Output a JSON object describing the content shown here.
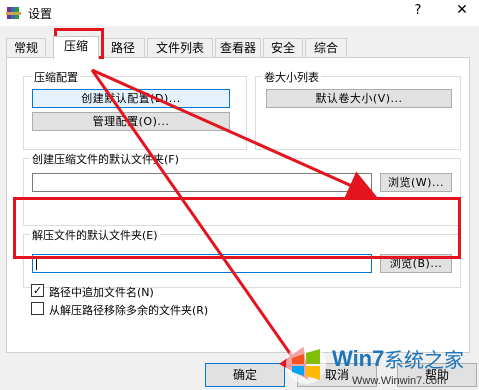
{
  "window": {
    "title": "设置",
    "help": "?",
    "close": "✕"
  },
  "tabs": [
    {
      "label": "常规"
    },
    {
      "label": "压缩"
    },
    {
      "label": "路径"
    },
    {
      "label": "文件列表"
    },
    {
      "label": "查看器"
    },
    {
      "label": "安全"
    },
    {
      "label": "综合"
    }
  ],
  "active_tab": "压缩",
  "compression_profiles": {
    "label": "压缩配置",
    "create_default": "创建默认配置(D)...",
    "manage": "管理配置(O)..."
  },
  "volume_sizes": {
    "label": "卷大小列表",
    "default_volume": "默认卷大小(V)..."
  },
  "create_archive_folder": {
    "label": "创建压缩文件的默认文件夹(F)",
    "value": "",
    "browse": "浏览(W)..."
  },
  "extract_folder": {
    "label": "解压文件的默认文件夹(E)",
    "value": "",
    "browse": "浏览(B)..."
  },
  "options": {
    "append_name": {
      "label": "路径中追加文件名(N)",
      "checked": true
    },
    "remove_redundant": {
      "label": "从解压路径移除多余的文件夹(R)",
      "checked": false
    }
  },
  "footer": {
    "ok": "确定",
    "cancel": "取消",
    "help": "帮助"
  },
  "watermark": {
    "brand": "系统之家",
    "logo_text": "Win7",
    "url": "Www.Winwin7.com"
  },
  "colors": {
    "highlight_red": "#e3141d",
    "focus_blue": "#0078d7"
  },
  "icons": {
    "app": "winrar-books-icon",
    "check": "checkmark-icon"
  }
}
